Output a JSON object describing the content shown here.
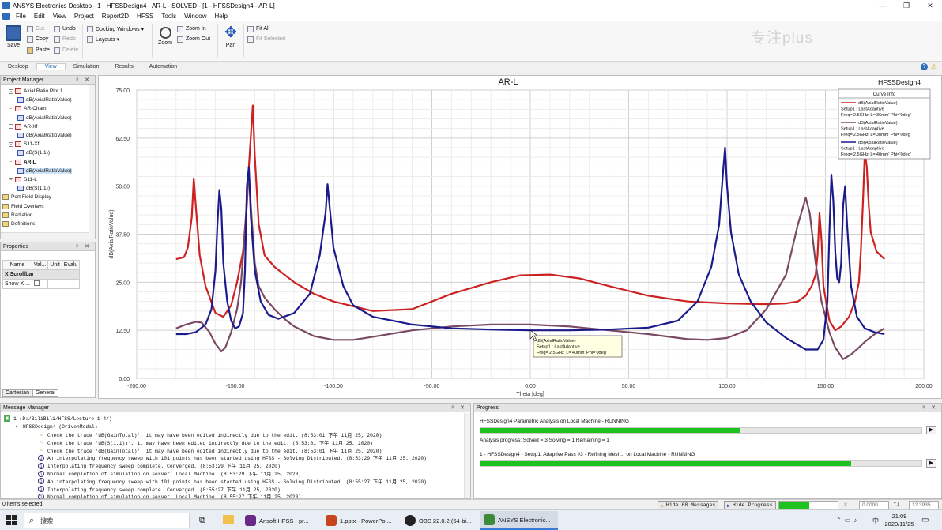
{
  "window": {
    "title": "ANSYS Electronics Desktop - 1 - HFSSDesign4 - AR-L - SOLVED - [1 - HFSSDesign4 - AR-L]",
    "controls": [
      "—",
      "❐",
      "✕"
    ]
  },
  "menu": [
    "File",
    "Edit",
    "View",
    "Project",
    "Report2D",
    "HFSS",
    "Tools",
    "Window",
    "Help"
  ],
  "ribbon": {
    "save": "Save",
    "cut": "Cut",
    "copy": "Copy",
    "paste": "Paste",
    "undo": "Undo",
    "redo": "Redo",
    "delete": "Delete",
    "docking": "Docking Windows ▾",
    "layouts": "Layouts ▾",
    "zoom": "Zoom",
    "zoom_in": "Zoom In",
    "zoom_out": "Zoom Out",
    "pan": "Pan",
    "fit_all": "Fit All",
    "fit_selected": "Fit Selected",
    "watermark": "专注plus"
  },
  "tabs": [
    "Desktop",
    "View",
    "Simulation",
    "Results",
    "Automation"
  ],
  "project_manager": {
    "title": "Project Manager",
    "items": [
      {
        "label": "Axial Ratio Plot 1",
        "level": 1,
        "icon": "report"
      },
      {
        "label": "dB(AxialRatioValue)",
        "level": 2,
        "icon": "trace"
      },
      {
        "label": "AR-Cham",
        "level": 1,
        "icon": "report"
      },
      {
        "label": "dB(AxialRatioValue)",
        "level": 2,
        "icon": "trace"
      },
      {
        "label": "AR-Xf",
        "level": 1,
        "icon": "report"
      },
      {
        "label": "dB(AxialRatioValue)",
        "level": 2,
        "icon": "trace"
      },
      {
        "label": "S11-Xf",
        "level": 1,
        "icon": "report"
      },
      {
        "label": "dB(S(1,1))",
        "level": 2,
        "icon": "trace"
      },
      {
        "label": "AR-L",
        "level": 1,
        "icon": "report",
        "bold": true
      },
      {
        "label": "dB(AxialRatioValue)",
        "level": 2,
        "icon": "trace",
        "selected": true
      },
      {
        "label": "S11-L",
        "level": 1,
        "icon": "report"
      },
      {
        "label": "dB(S(1,1))",
        "level": 2,
        "icon": "trace"
      },
      {
        "label": "Port Field Display",
        "level": 0,
        "icon": "folder"
      },
      {
        "label": "Field Overlays",
        "level": 0,
        "icon": "folder"
      },
      {
        "label": "Radiation",
        "level": 0,
        "icon": "folder"
      },
      {
        "label": "Definitions",
        "level": 0,
        "icon": "folder"
      }
    ]
  },
  "properties": {
    "title": "Properties",
    "columns": [
      "Name",
      "Val...",
      "Unit",
      "Evalu"
    ],
    "section": "X Scrollbar",
    "row_name": "Show X ...",
    "tabs": [
      "Cartesian",
      "General"
    ]
  },
  "chart_data": {
    "type": "line",
    "title": "AR-L",
    "design": "HFSSDesign4",
    "xlabel": "Theta [deg]",
    "ylabel": "dB(AxialRatioValue)",
    "xlim": [
      -200,
      200
    ],
    "ylim": [
      0,
      75
    ],
    "xticks": [
      -200,
      -150,
      -100,
      -50,
      0,
      50,
      100,
      150,
      200
    ],
    "yticks": [
      0,
      12.5,
      25,
      37.5,
      50,
      62.5,
      75
    ],
    "xtick_labels": [
      "-200.00",
      "-150.00",
      "-100.00",
      "-50.00",
      "0.00",
      "50.00",
      "100.00",
      "150.00",
      "200.00"
    ],
    "ytick_labels": [
      "0.00",
      "12.50",
      "25.00",
      "37.50",
      "50.00",
      "62.50",
      "75.00"
    ],
    "grid": true,
    "legend_title": "Curve Info",
    "legend_position": "top-right",
    "series": [
      {
        "color": "#cc2222",
        "legend": [
          "dB(AxialRatioValue)",
          "Setup1 : LastAdaptive",
          "Freq='2.5GHz' L='36mm' Phi='0deg'"
        ],
        "points": [
          [
            -180,
            31
          ],
          [
            -176,
            31.5
          ],
          [
            -174,
            34
          ],
          [
            -172,
            42
          ],
          [
            -171,
            52
          ],
          [
            -170,
            45
          ],
          [
            -168,
            32
          ],
          [
            -165,
            24
          ],
          [
            -160,
            17
          ],
          [
            -156,
            16
          ],
          [
            -152,
            19
          ],
          [
            -149,
            25
          ],
          [
            -146,
            33
          ],
          [
            -144,
            45
          ],
          [
            -143,
            55
          ],
          [
            -141,
            71
          ],
          [
            -140,
            58
          ],
          [
            -138,
            40
          ],
          [
            -135,
            32
          ],
          [
            -130,
            29
          ],
          [
            -120,
            25
          ],
          [
            -110,
            22
          ],
          [
            -100,
            20
          ],
          [
            -80,
            17.5
          ],
          [
            -60,
            18
          ],
          [
            -50,
            20
          ],
          [
            -40,
            22
          ],
          [
            -20,
            25
          ],
          [
            -5,
            26.8
          ],
          [
            10,
            27
          ],
          [
            25,
            26
          ],
          [
            40,
            24
          ],
          [
            60,
            21.5
          ],
          [
            80,
            20
          ],
          [
            100,
            19.5
          ],
          [
            120,
            19.3
          ],
          [
            130,
            19.5
          ],
          [
            136,
            20
          ],
          [
            140,
            21.5
          ],
          [
            143,
            24
          ],
          [
            145,
            27
          ],
          [
            146,
            32
          ],
          [
            147,
            43
          ],
          [
            148,
            36
          ],
          [
            149,
            24
          ],
          [
            152,
            15
          ],
          [
            155,
            12.5
          ],
          [
            158,
            13.5
          ],
          [
            162,
            16
          ],
          [
            165,
            20
          ],
          [
            167,
            25
          ],
          [
            168,
            33
          ],
          [
            169,
            45
          ],
          [
            170,
            59
          ],
          [
            171,
            55
          ],
          [
            172,
            45
          ],
          [
            173,
            38
          ],
          [
            176,
            33
          ],
          [
            180,
            31
          ]
        ]
      },
      {
        "color": "#7a4a64",
        "legend": [
          "dB(AxialRatioValue)",
          "Setup1 : LastAdaptive",
          "Freq='2.5GHz' L='38mm' Phi='0deg'"
        ],
        "points": [
          [
            -180,
            13
          ],
          [
            -175,
            14
          ],
          [
            -170,
            14.7
          ],
          [
            -167,
            14.5
          ],
          [
            -163,
            12
          ],
          [
            -160,
            9
          ],
          [
            -157,
            7
          ],
          [
            -155,
            8
          ],
          [
            -152,
            12
          ],
          [
            -149,
            18
          ],
          [
            -147,
            25
          ],
          [
            -145,
            38
          ],
          [
            -144,
            47
          ],
          [
            -143,
            54
          ],
          [
            -142,
            45
          ],
          [
            -140,
            30
          ],
          [
            -138,
            24
          ],
          [
            -135,
            21
          ],
          [
            -130,
            18
          ],
          [
            -125,
            15.5
          ],
          [
            -120,
            13.5
          ],
          [
            -110,
            11
          ],
          [
            -100,
            10
          ],
          [
            -90,
            10
          ],
          [
            -80,
            10.8
          ],
          [
            -60,
            12.5
          ],
          [
            -40,
            13.5
          ],
          [
            -20,
            14
          ],
          [
            0,
            14
          ],
          [
            20,
            13.5
          ],
          [
            40,
            12.5
          ],
          [
            60,
            11.5
          ],
          [
            80,
            10.2
          ],
          [
            90,
            10
          ],
          [
            100,
            10.5
          ],
          [
            110,
            12.5
          ],
          [
            120,
            18
          ],
          [
            130,
            27
          ],
          [
            136,
            40
          ],
          [
            140,
            47
          ],
          [
            142,
            43
          ],
          [
            145,
            30
          ],
          [
            148,
            20
          ],
          [
            152,
            12
          ],
          [
            155,
            8
          ],
          [
            159,
            5
          ],
          [
            163,
            6.2
          ],
          [
            167,
            8
          ],
          [
            170,
            9.5
          ],
          [
            175,
            11.5
          ],
          [
            180,
            13
          ]
        ]
      },
      {
        "color": "#1a1a8c",
        "legend": [
          "dB(AxialRatioValue)",
          "Setup1 : LastAdaptive",
          "Freq='2.5GHz' L='40mm' Phi='0deg'"
        ],
        "points": [
          [
            -180,
            11.5
          ],
          [
            -175,
            11.5
          ],
          [
            -170,
            12
          ],
          [
            -165,
            14
          ],
          [
            -162,
            18
          ],
          [
            -160,
            28
          ],
          [
            -159,
            40
          ],
          [
            -158,
            49
          ],
          [
            -157,
            44
          ],
          [
            -156,
            30
          ],
          [
            -154,
            20
          ],
          [
            -152,
            15
          ],
          [
            -150,
            13
          ],
          [
            -148,
            13.5
          ],
          [
            -146,
            17
          ],
          [
            -145,
            28
          ],
          [
            -144,
            50
          ],
          [
            -143,
            55
          ],
          [
            -142,
            42
          ],
          [
            -140,
            28
          ],
          [
            -137,
            20
          ],
          [
            -133,
            16.5
          ],
          [
            -128,
            15.5
          ],
          [
            -120,
            17
          ],
          [
            -112,
            22
          ],
          [
            -107,
            32
          ],
          [
            -104,
            43
          ],
          [
            -103,
            50.5
          ],
          [
            -102,
            45
          ],
          [
            -100,
            34
          ],
          [
            -95,
            24
          ],
          [
            -90,
            19
          ],
          [
            -80,
            16
          ],
          [
            -60,
            14
          ],
          [
            -40,
            13
          ],
          [
            -20,
            12.7
          ],
          [
            0,
            12.5
          ],
          [
            20,
            12.5
          ],
          [
            40,
            12.7
          ],
          [
            60,
            13.2
          ],
          [
            75,
            15
          ],
          [
            85,
            20
          ],
          [
            92,
            29
          ],
          [
            96,
            40
          ],
          [
            98,
            54
          ],
          [
            99,
            60
          ],
          [
            100,
            50
          ],
          [
            102,
            38
          ],
          [
            106,
            27
          ],
          [
            112,
            20
          ],
          [
            120,
            14.5
          ],
          [
            130,
            10.5
          ],
          [
            140,
            7.5
          ],
          [
            146,
            7.5
          ],
          [
            149,
            10
          ],
          [
            151,
            20
          ],
          [
            152,
            38
          ],
          [
            153,
            53
          ],
          [
            154,
            46
          ],
          [
            155,
            33
          ],
          [
            156,
            26
          ],
          [
            157,
            25
          ],
          [
            158,
            30
          ],
          [
            159,
            45
          ],
          [
            160,
            50
          ],
          [
            161,
            40
          ],
          [
            163,
            24
          ],
          [
            166,
            16
          ],
          [
            170,
            13
          ],
          [
            175,
            12
          ],
          [
            180,
            11.5
          ]
        ]
      }
    ],
    "tooltip": [
      "dB(AxialRatioValue)",
      "Setup1 : LastAdaptive",
      "Freq='2.5GHz' L='40mm' Phi='0deg'"
    ]
  },
  "messages": {
    "title": "Message Manager",
    "root": "1 (D:/BiliBili/HFSS/Lecture 1-4/)",
    "design": "HFSSDesign4 (DrivenModal)",
    "lines": [
      {
        "type": "warn",
        "text": "Check the trace 'dB(GainTotal)', it may have been edited indirectly due to the edit. (8:53:01 下午  11月 25, 2020)"
      },
      {
        "type": "warn",
        "text": "Check the trace 'dB(S(1,1))', it may have been edited indirectly due to the edit. (8:53:01 下午  11月 25, 2020)"
      },
      {
        "type": "warn",
        "text": "Check the trace 'dB(GainTotal)', it may have been edited indirectly due to the edit. (8:53:01 下午  11月 25, 2020)"
      },
      {
        "type": "info",
        "text": "An interpolating frequency sweep with 101 points has been started using HFSS - Solving Distributed. (8:53:29 下午  11月 25, 2020)"
      },
      {
        "type": "info",
        "text": "Interpolating frequency sweep complete. Converged. (8:53:29 下午  11月 25, 2020)"
      },
      {
        "type": "info",
        "text": "Normal completion of simulation on server: Local Machine. (8:53:29 下午  11月 25, 2020)"
      },
      {
        "type": "info",
        "text": "An interpolating frequency sweep with 101 points has been started using HFSS - Solving Distributed. (8:55:27 下午  11月 25, 2020)"
      },
      {
        "type": "info",
        "text": "Interpolating frequency sweep complete. Converged. (8:55:27 下午  11月 25, 2020)"
      },
      {
        "type": "info",
        "text": "Normal completion of simulation on server: Local Machine. (8:55:27 下午  11月 25, 2020)"
      }
    ]
  },
  "progress": {
    "title": "Progress",
    "job1": "HFSSDesign4 Parametric Analysis on Local Machine - RUNNING",
    "job1_fraction": 0.59,
    "stats": "Analysis progress:   Solved = 3   Solving = 1   Remaining = 1",
    "job2": "1 - HFSSDesign4 - Setup1: Adaptive Pass #3 - Refining Mesh... on Local Machine - RUNNING",
    "job2_fraction": 0.84
  },
  "status": {
    "selected": "0 items selected.",
    "hide_messages": "Hide 68 Messages",
    "hide_progress": "Hide Progress",
    "x_value": "0.0000",
    "y_label": "Y1",
    "y_value": "12.3935",
    "progress_fraction": 0.52
  },
  "taskbar": {
    "search": "搜索",
    "apps": [
      "Ansoft HFSS - pr...",
      "1.pptx - PowerPoi...",
      "OBS 22.0.2 (64-bi...",
      "ANSYS Electronic..."
    ],
    "time": "21:09",
    "date": "2020/11/25",
    "ime": "中"
  }
}
